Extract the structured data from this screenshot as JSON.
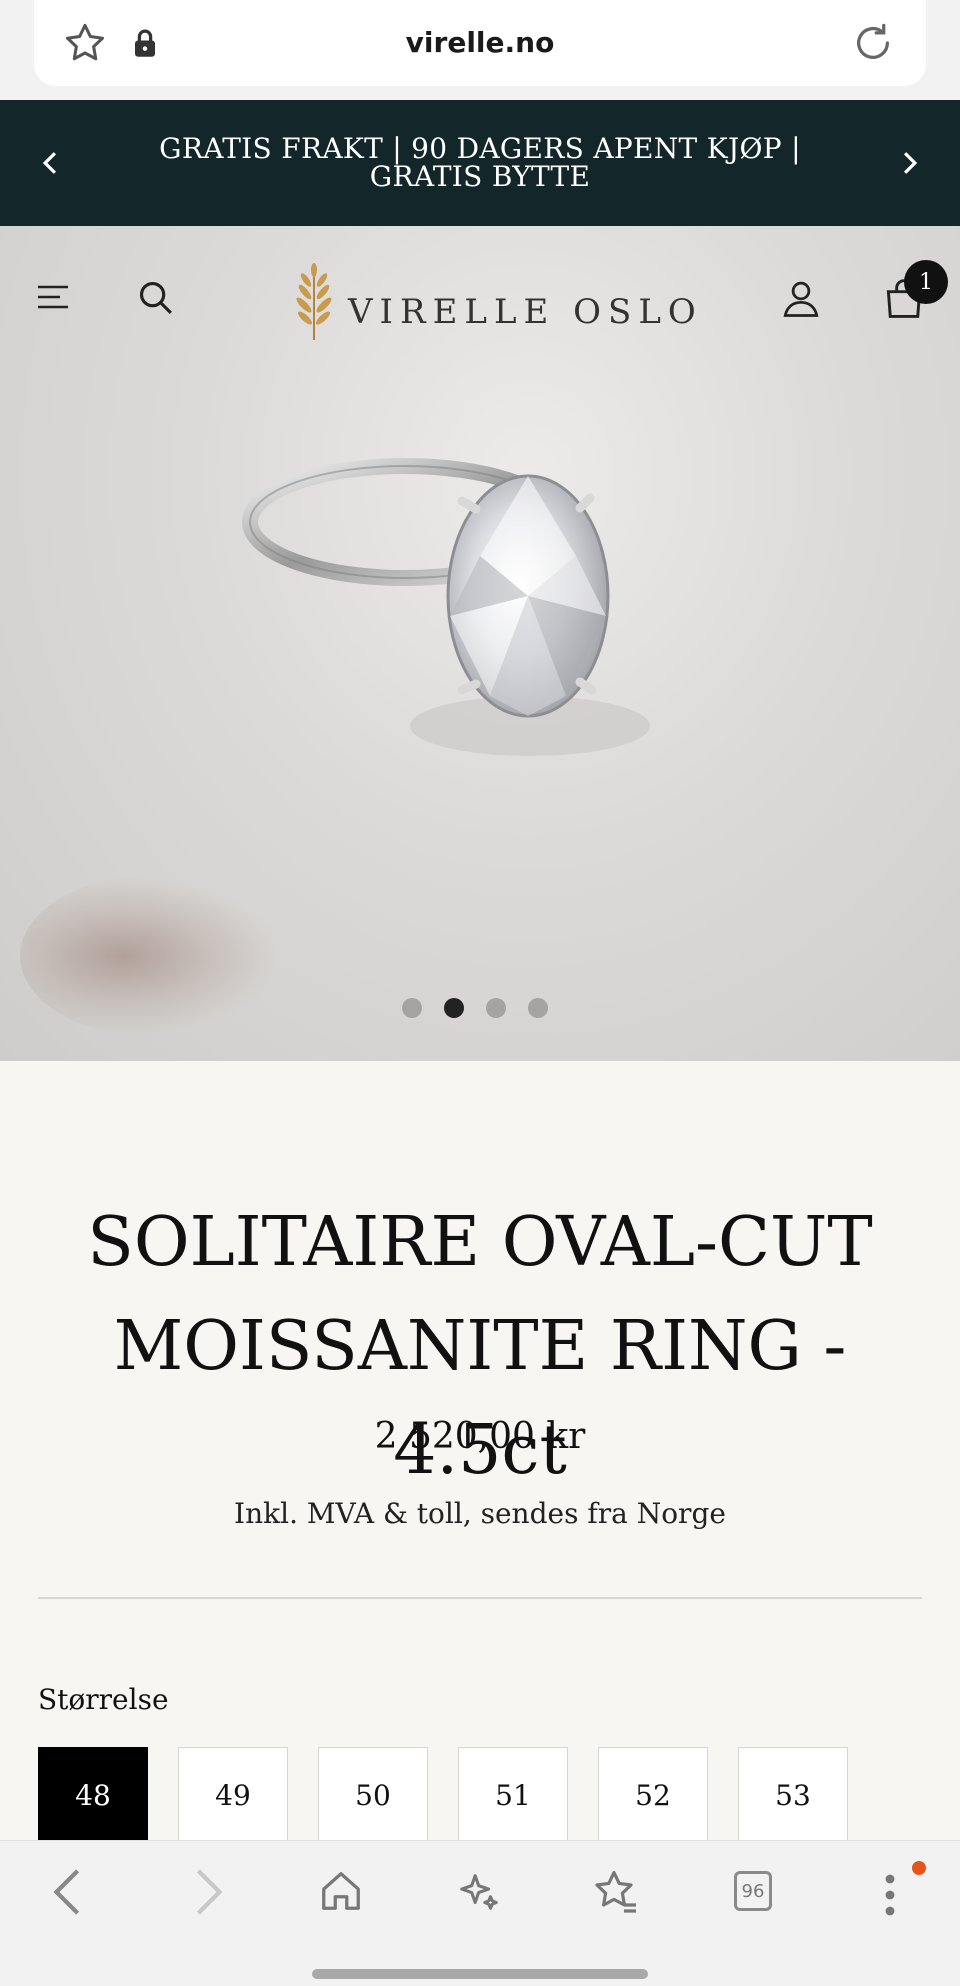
{
  "browser": {
    "url": "virelle.no"
  },
  "announcement": {
    "line1": "GRATIS FRAKT | 90 DAGERS APENT KJØP |",
    "line2": "GRATIS BYTTE"
  },
  "header": {
    "brand": "VIRELLE OSLO",
    "cart_count": "1"
  },
  "carousel": {
    "slide_count": 4,
    "active_index": 1
  },
  "product": {
    "title_line1": "SOLITAIRE OVAL-CUT",
    "title_line2": "MOISSANITE RING - 4.5ct",
    "price": "2 520,00 kr",
    "tax_note": "Inkl. MVA & toll, sendes fra Norge",
    "size_label": "Størrelse",
    "sizes": [
      "48",
      "49",
      "50",
      "51",
      "52",
      "53"
    ],
    "selected_size": "48"
  },
  "bottom_nav": {
    "tab_count": "96"
  },
  "colors": {
    "announcement_bg": "#13262a",
    "page_bg": "#f7f6f3",
    "selected_size_bg": "#000000",
    "notification_dot": "#e4541c"
  }
}
